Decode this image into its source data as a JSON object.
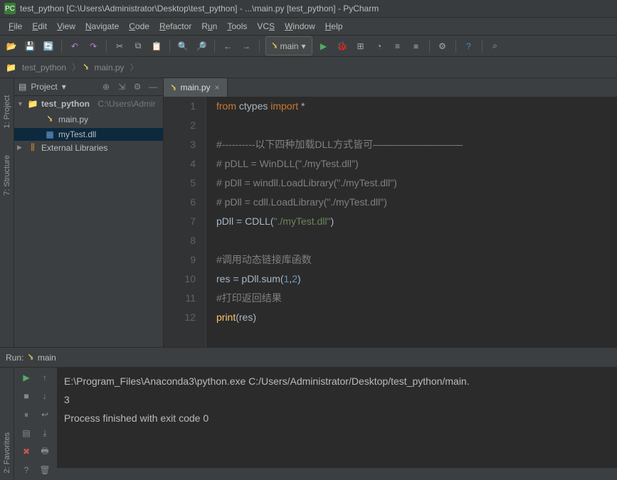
{
  "title": "test_python [C:\\Users\\Administrator\\Desktop\\test_python] - ...\\main.py [test_python] - PyCharm",
  "menu": [
    "File",
    "Edit",
    "View",
    "Navigate",
    "Code",
    "Refactor",
    "Run",
    "Tools",
    "VCS",
    "Window",
    "Help"
  ],
  "run_config": "main",
  "breadcrumb": {
    "root": "test_python",
    "file": "main.py"
  },
  "sidebar": {
    "title": "Project",
    "project": {
      "name": "test_python",
      "path": "C:\\Users\\Admir"
    },
    "files": [
      "main.py",
      "myTest.dll"
    ],
    "external": "External Libraries"
  },
  "tab": {
    "label": "main.py"
  },
  "code_lines": [
    1,
    2,
    3,
    4,
    5,
    6,
    7,
    8,
    9,
    10,
    11,
    12
  ],
  "code": {
    "l1a": "from ",
    "l1b": "ctypes ",
    "l1c": "import ",
    "l1d": "*",
    "l3": "#----------以下四种加载DLL方式皆可—————————",
    "l4": "# pDLL = WinDLL(\"./myTest.dll\")",
    "l5": "# pDll = windll.LoadLibrary(\"./myTest.dll\")",
    "l6": "# pDll = cdll.LoadLibrary(\"./myTest.dll\")",
    "l7a": "pDll = CDLL(",
    "l7b": "\"./myTest.dll\"",
    "l7c": ")",
    "l9": "#调用动态链接库函数",
    "l10a": "res = pDll.sum(",
    "l10b": "1",
    "l10c": ",",
    "l10d": "2",
    "l10e": ")",
    "l11": "#打印返回结果",
    "l12a": "print",
    "l12b": "(res)"
  },
  "run": {
    "title": "Run:",
    "name": "main",
    "out1": "E:\\Program_Files\\Anaconda3\\python.exe C:/Users/Administrator/Desktop/test_python/main.",
    "out2": "3",
    "out3": "",
    "out4": "Process finished with exit code 0"
  },
  "left_tabs": {
    "project": "1: Project",
    "structure": "7: Structure",
    "favorites": "2: Favorites"
  }
}
